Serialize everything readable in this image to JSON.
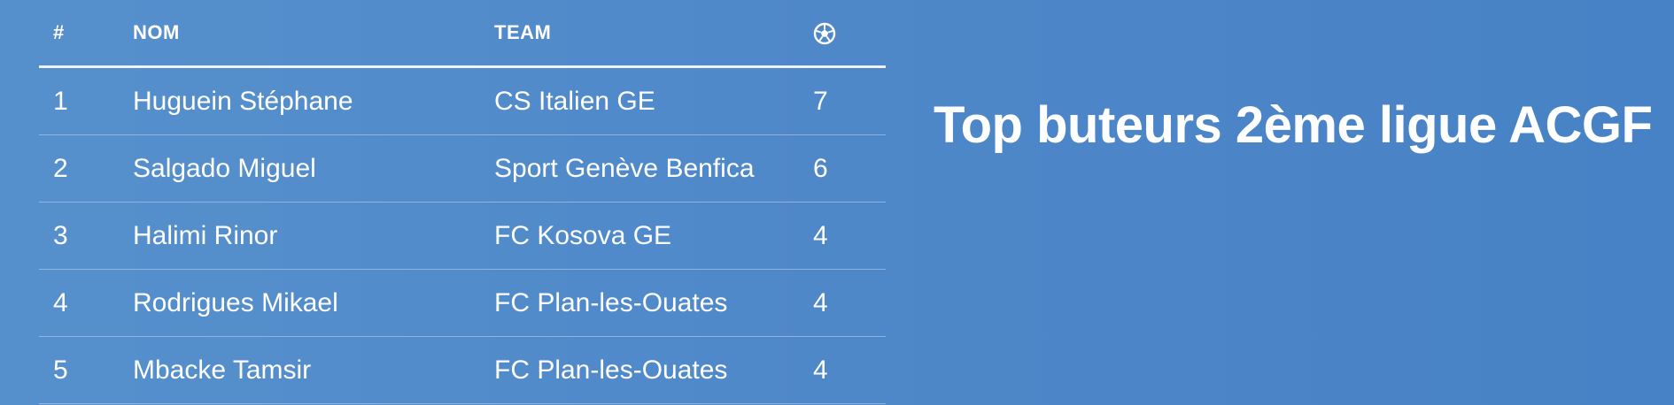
{
  "title": "Top buteurs 2ème ligue ACGF",
  "table": {
    "headers": {
      "rank": "#",
      "name": "NOM",
      "team": "TEAM",
      "goals_icon": "soccer-ball-icon"
    },
    "rows": [
      {
        "rank": "1",
        "name": "Huguein Stéphane",
        "team": "CS Italien GE",
        "goals": "7"
      },
      {
        "rank": "2",
        "name": "Salgado Miguel",
        "team": "Sport Genève Benfica",
        "goals": "6"
      },
      {
        "rank": "3",
        "name": "Halimi Rinor",
        "team": "FC Kosova GE",
        "goals": "4"
      },
      {
        "rank": "4",
        "name": "Rodrigues Mikael",
        "team": "FC Plan-les-Ouates",
        "goals": "4"
      },
      {
        "rank": "5",
        "name": "Mbacke Tamsir",
        "team": "FC Plan-les-Ouates",
        "goals": "4"
      }
    ]
  }
}
